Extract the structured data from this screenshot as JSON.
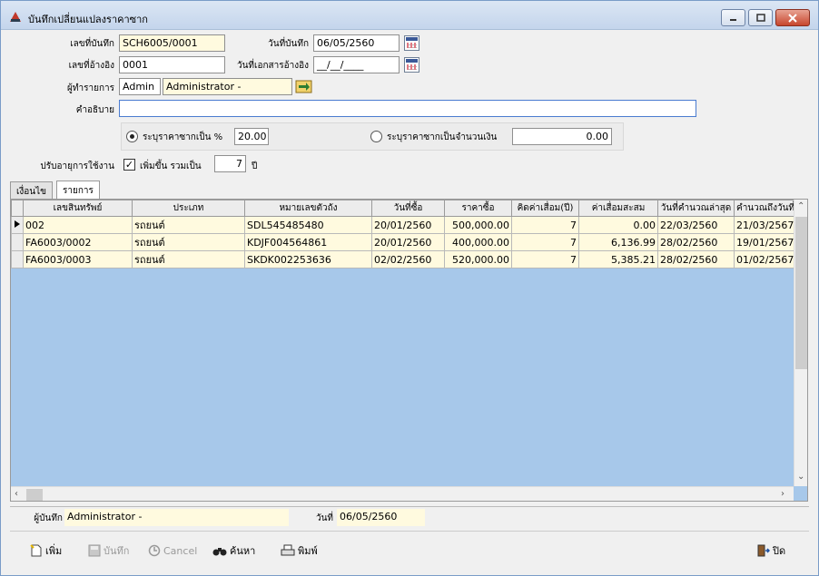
{
  "window": {
    "title": "บันทึกเปลี่ยนแปลงราคาซาก"
  },
  "form": {
    "doc_no_label": "เลขที่บันทึก",
    "doc_no": "SCH6005/0001",
    "doc_date_label": "วันที่บันทึก",
    "doc_date": "06/05/2560",
    "ref_no_label": "เลขที่อ้างอิง",
    "ref_no": "0001",
    "ref_date_label": "วันที่เอกสารอ้างอิง",
    "ref_date": "__/__/____",
    "operator_label": "ผู้ทำรายการ",
    "operator_code": "Admin",
    "operator_name": "Administrator -",
    "description_label": "คำอธิบาย",
    "description": "",
    "radio_percent_label": "ระบุราคาซากเป็น %",
    "percent_value": "20.00",
    "radio_amount_label": "ระบุราคาซากเป็นจำนวนเงิน",
    "amount_value": "0.00",
    "lifetime_label": "ปรับอายุการใช้งาน",
    "increase_label": "เพิ่มขึ้น รวมเป็น",
    "years_value": "7",
    "years_unit": "ปี"
  },
  "tabs": [
    {
      "label": "เงื่อนไข"
    },
    {
      "label": "รายการ"
    }
  ],
  "grid": {
    "columns": [
      "เลขสินทรัพย์",
      "ประเภท",
      "หมายเลขตัวถัง",
      "วันที่ซื้อ",
      "ราคาซื้อ",
      "คิดค่าเสื่อม(ปี)",
      "ค่าเสื่อมสะสม",
      "วันที่คำนวณล่าสุด",
      "คำนวณถึงวันที่"
    ],
    "rows": [
      [
        "002",
        "รถยนต์",
        "SDL545485480",
        "20/01/2560",
        "500,000.00",
        "7",
        "0.00",
        "22/03/2560",
        "21/03/2567"
      ],
      [
        "FA6003/0002",
        "รถยนต์",
        "KDJF004564861",
        "20/01/2560",
        "400,000.00",
        "7",
        "6,136.99",
        "28/02/2560",
        "19/01/2567"
      ],
      [
        "FA6003/0003",
        "รถยนต์",
        "SKDK002253636",
        "02/02/2560",
        "520,000.00",
        "7",
        "5,385.21",
        "28/02/2560",
        "01/02/2567"
      ]
    ]
  },
  "footer": {
    "recorder_label": "ผู้บันทึก",
    "recorder": "Administrator -",
    "date_label": "วันที่",
    "date": "06/05/2560"
  },
  "toolbar": {
    "add": "เพิ่ม",
    "save": "บันทึก",
    "cancel": "Cancel",
    "search": "ค้นหา",
    "print": "พิมพ์",
    "close": "ปิด"
  },
  "icons": [
    "app-icon",
    "calendar-icon",
    "lookup-icon",
    "add-icon",
    "save-icon",
    "cancel-icon",
    "binoculars-icon",
    "printer-icon",
    "exit-icon"
  ]
}
